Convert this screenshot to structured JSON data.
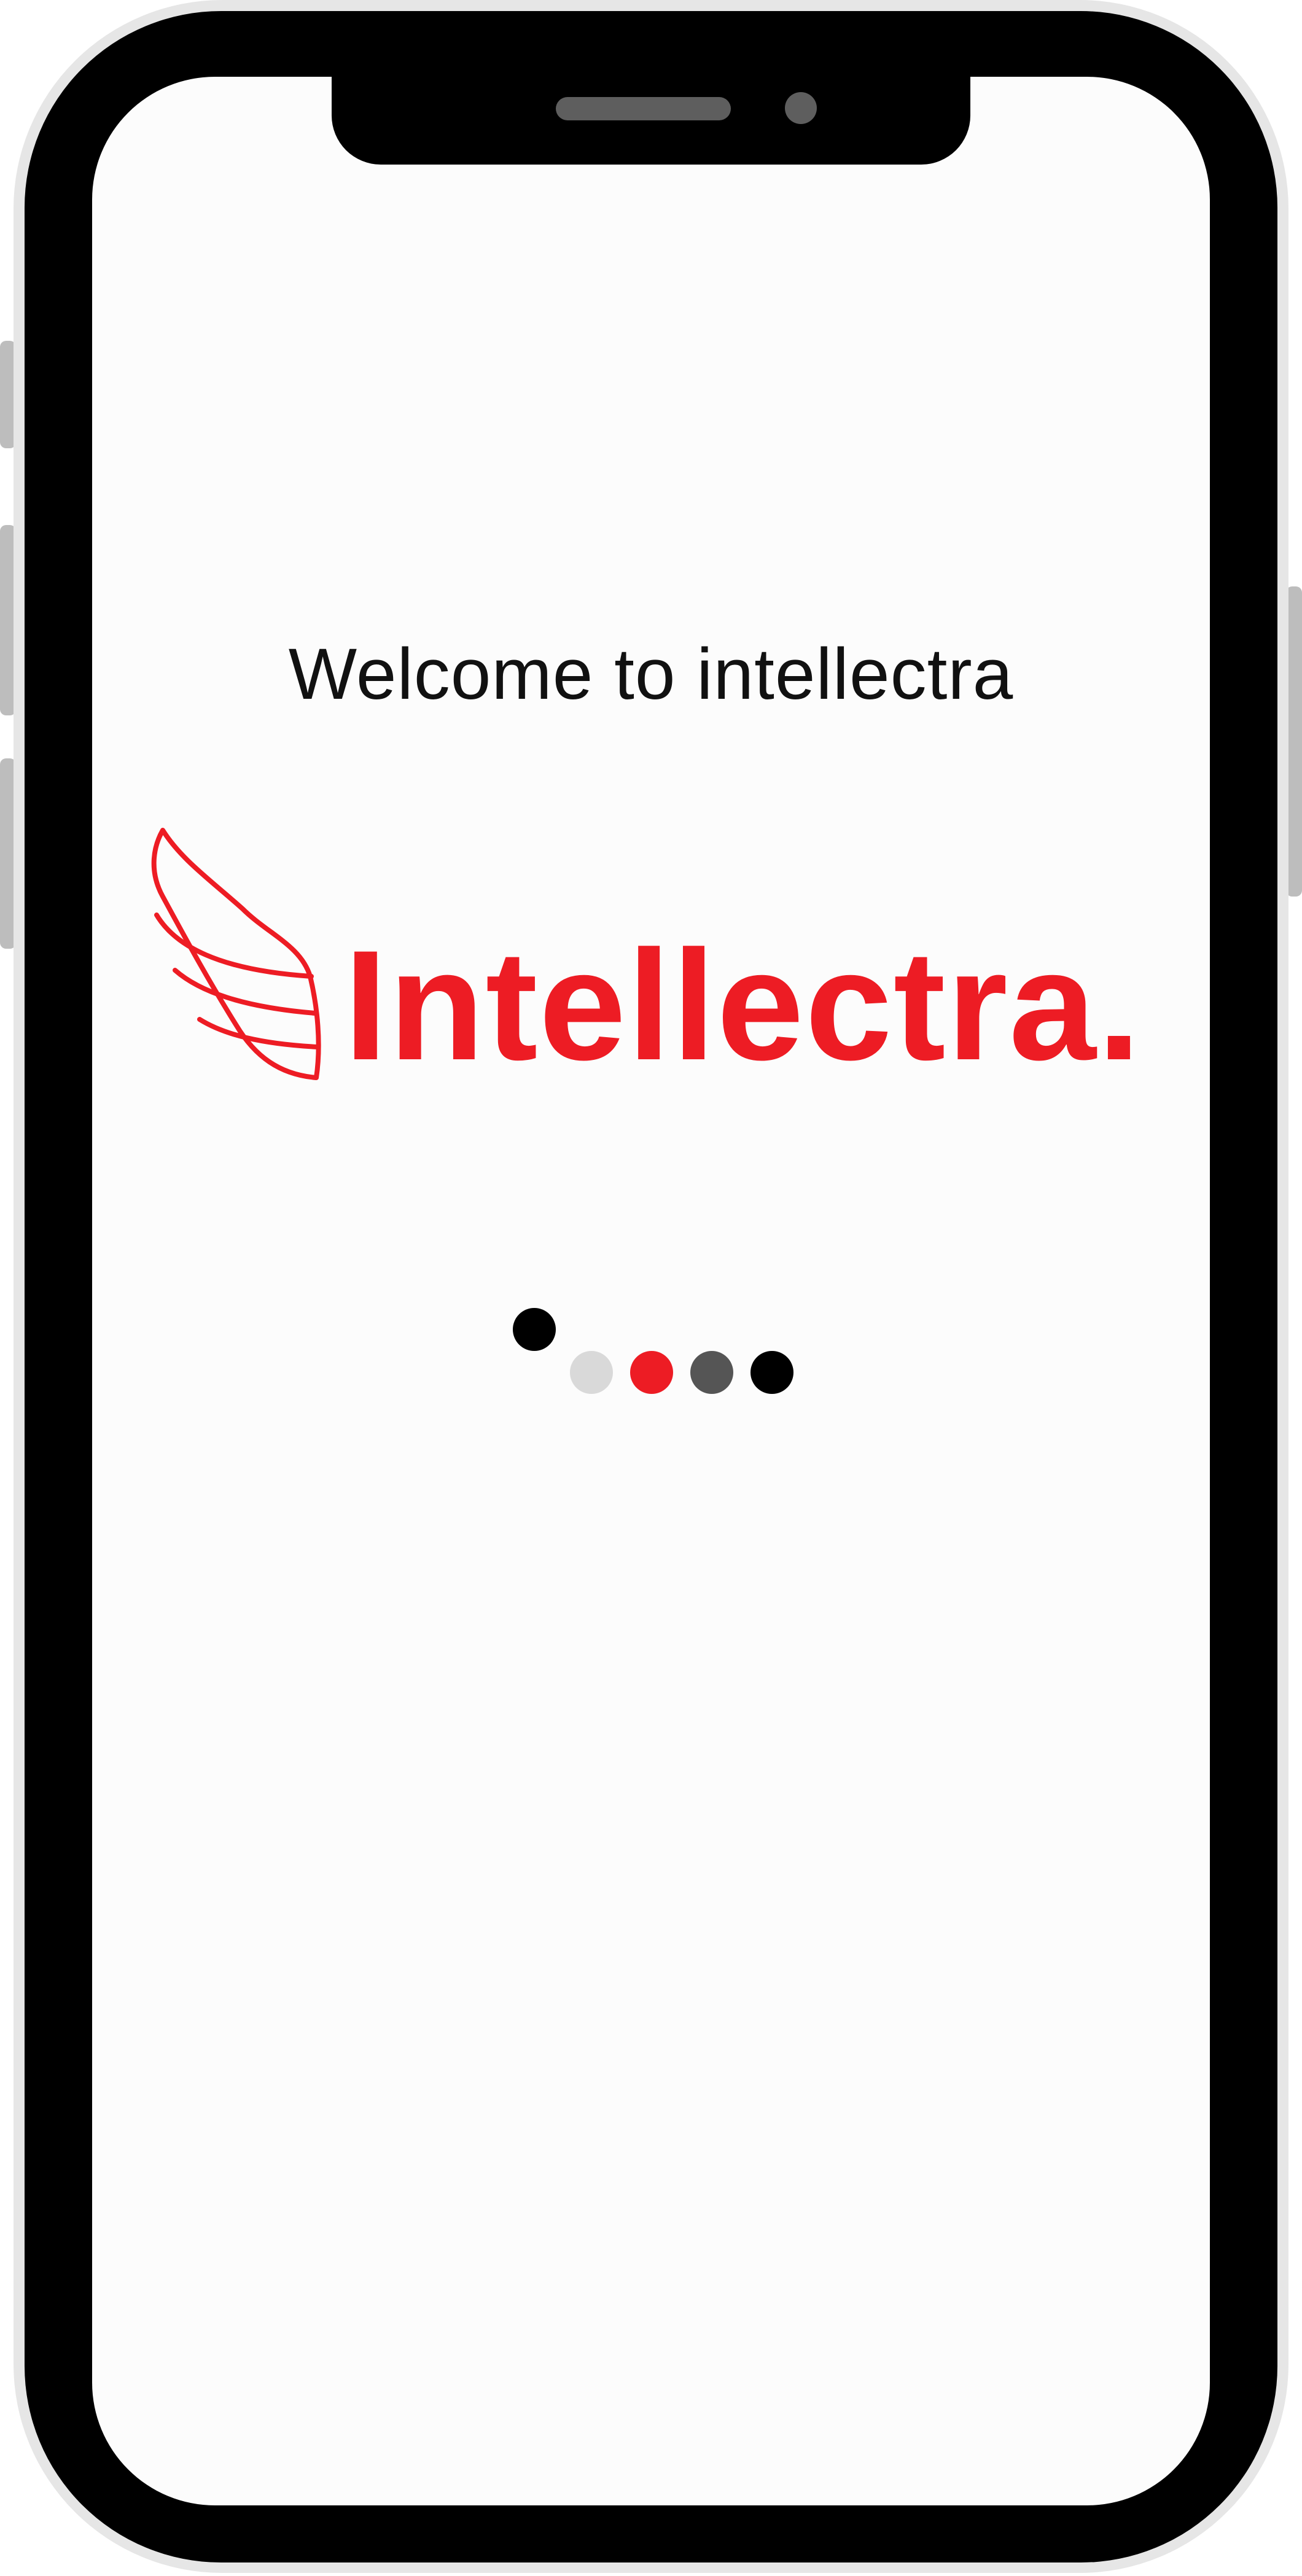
{
  "screen": {
    "welcome_text": "Welcome to intellectra",
    "logo": {
      "text": "Intellectra.",
      "icon": "wing-icon",
      "color": "#ed1c24"
    },
    "loading_indicator": {
      "icon": "loading-dots-icon",
      "dot_colors": [
        "#000000",
        "#d9d9d9",
        "#ed1c24",
        "#555555",
        "#000000"
      ]
    }
  },
  "device": {
    "frame_color": "#000000",
    "rim_color": "#e6e6e6",
    "screen_color": "#fcfcfc"
  }
}
